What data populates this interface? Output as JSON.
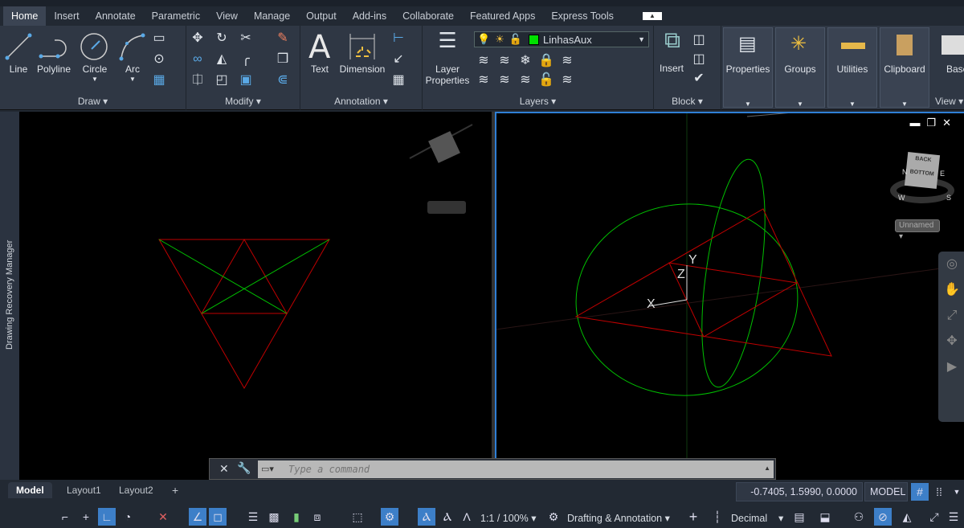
{
  "ribbon_tabs": [
    "Home",
    "Insert",
    "Annotate",
    "Parametric",
    "View",
    "Manage",
    "Output",
    "Add-ins",
    "Collaborate",
    "Featured Apps",
    "Express Tools"
  ],
  "active_tab": "Home",
  "draw": {
    "label": "Draw",
    "line": "Line",
    "polyline": "Polyline",
    "circle": "Circle",
    "arc": "Arc"
  },
  "modify": {
    "label": "Modify"
  },
  "annotation": {
    "label": "Annotation",
    "text": "Text",
    "dimension": "Dimension"
  },
  "layers": {
    "label": "Layers",
    "properties": "Layer Properties",
    "current_layer": "LinhasAux",
    "layer_color": "#00e000"
  },
  "block": {
    "label": "Block",
    "insert": "Insert"
  },
  "groups": {
    "properties": "Properties",
    "groups": "Groups",
    "utilities": "Utilities",
    "clipboard": "Clipboard",
    "base": "Base",
    "view": "View"
  },
  "palette": {
    "title": "Drawing Recovery Manager"
  },
  "viewcube": {
    "top": "BACK",
    "face": "BOTTOM",
    "compass": [
      "N",
      "E",
      "S",
      "W"
    ],
    "view_name": "Unnamed"
  },
  "ucs": {
    "x": "X",
    "y": "Y",
    "z": "Z"
  },
  "command": {
    "placeholder": "Type a command"
  },
  "layout_tabs": [
    "Model",
    "Layout1",
    "Layout2"
  ],
  "status": {
    "coords": "-0.7405, 1.5990, 0.0000",
    "space": "MODEL",
    "scale": "1:1 / 100%",
    "workspace": "Drafting & Annotation",
    "units": "Decimal"
  },
  "colors": {
    "red_lines": "#c00000",
    "green_lines": "#00c000",
    "viewport_border": "#2f7fd6"
  }
}
